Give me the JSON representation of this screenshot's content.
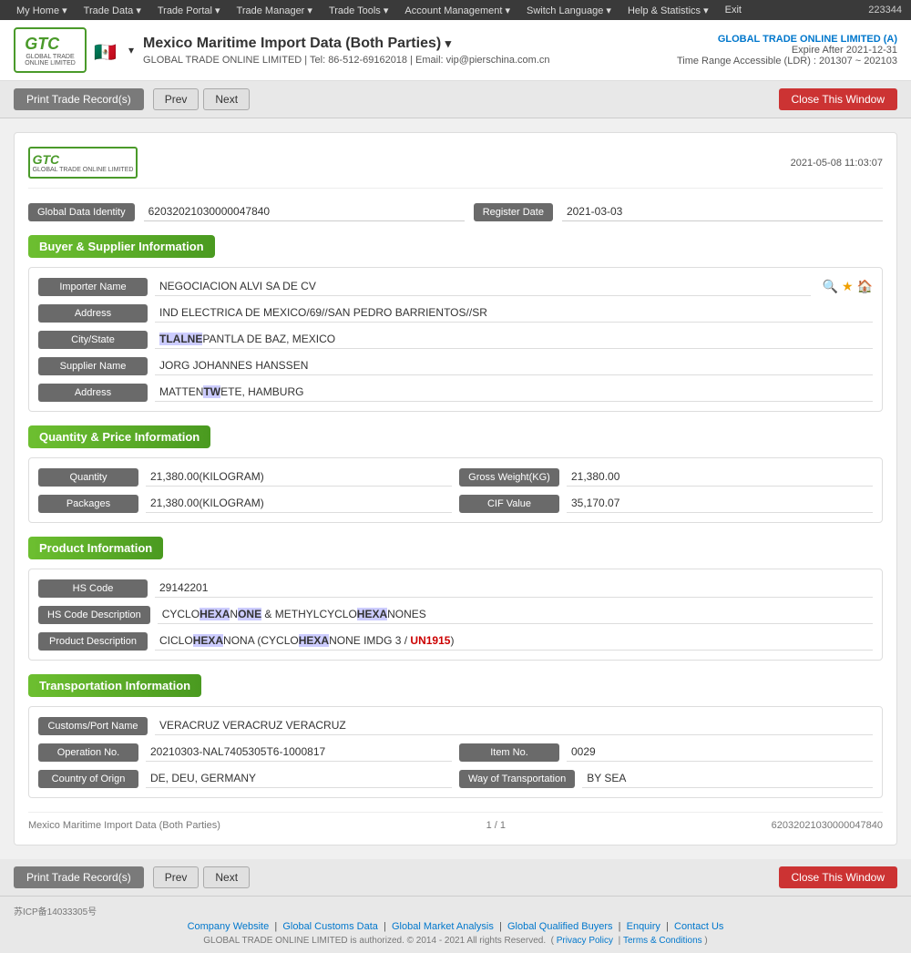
{
  "topnav": {
    "items": [
      "My Home",
      "Trade Data",
      "Trade Portal",
      "Trade Manager",
      "Trade Tools",
      "Account Management",
      "Switch Language",
      "Help & Statistics",
      "Exit"
    ],
    "account_id": "223344"
  },
  "header": {
    "logo_text": "GTC",
    "logo_sub": "GLOBAL TRADE ONLINE LIMITED",
    "flag_emoji": "🇲🇽",
    "title": "Mexico Maritime Import Data (Both Parties)",
    "contact": "GLOBAL TRADE ONLINE LIMITED | Tel: 86-512-69162018 | Email: vip@pierschina.com.cn",
    "account_name": "GLOBAL TRADE ONLINE LIMITED (A)",
    "expire": "Expire After 2021-12-31",
    "time_range": "Time Range Accessible (LDR) : 201307 ~ 202103"
  },
  "toolbar": {
    "print_label": "Print Trade Record(s)",
    "prev_label": "Prev",
    "next_label": "Next",
    "close_label": "Close This Window"
  },
  "record": {
    "datetime": "2021-05-08 11:03:07",
    "global_data_identity_label": "Global Data Identity",
    "global_data_identity_value": "62032021030000047840",
    "register_date_label": "Register Date",
    "register_date_value": "2021-03-03",
    "buyer_supplier_section": "Buyer & Supplier Information",
    "importer_name_label": "Importer Name",
    "importer_name_value": "NEGOCIACION ALVI SA DE CV",
    "address1_label": "Address",
    "address1_value": "IND ELECTRICA DE MEXICO/69//SAN PEDRO BARRIENTOS//SR",
    "city_state_label": "City/State",
    "city_state_value": "TLALNEPANTLA DE BAZ, MEXICO",
    "supplier_name_label": "Supplier Name",
    "supplier_name_value": "JORG JOHANNES HANSSEN",
    "address2_label": "Address",
    "address2_value": "MATTENTWETE, HAMBURG",
    "qty_price_section": "Quantity & Price Information",
    "quantity_label": "Quantity",
    "quantity_value": "21,380.00(KILOGRAM)",
    "gross_weight_label": "Gross Weight(KG)",
    "gross_weight_value": "21,380.00",
    "packages_label": "Packages",
    "packages_value": "21,380.00(KILOGRAM)",
    "cif_value_label": "CIF Value",
    "cif_value_value": "35,170.07",
    "product_section": "Product Information",
    "hs_code_label": "HS Code",
    "hs_code_value": "29142201",
    "hs_code_desc_label": "HS Code Description",
    "hs_code_desc_value": "CYCLOHEXANONE & METHYLCYCLOHEXANONES",
    "product_desc_label": "Product Description",
    "product_desc_value": "CICLOHEXANONA (CYCLOHEXANONE IMDG 3 / UN1915)",
    "transport_section": "Transportation Information",
    "customs_label": "Customs/Port Name",
    "customs_value": "VERACRUZ VERACRUZ VERACRUZ",
    "operation_label": "Operation No.",
    "operation_value": "20210303-NAL7405305T6-1000817",
    "item_no_label": "Item No.",
    "item_no_value": "0029",
    "country_label": "Country of Orign",
    "country_value": "DE, DEU, GERMANY",
    "way_transport_label": "Way of Transportation",
    "way_transport_value": "BY SEA",
    "footer_title": "Mexico Maritime Import Data (Both Parties)",
    "footer_page": "1 / 1",
    "footer_id": "62032021030000047840"
  },
  "page_footer": {
    "icp": "苏ICP备14033305号",
    "links": [
      "Company Website",
      "Global Customs Data",
      "Global Market Analysis",
      "Global Qualified Buyers",
      "Enquiry",
      "Contact Us"
    ],
    "separator": "|",
    "copy": "GLOBAL TRADE ONLINE LIMITED is authorized. © 2014 - 2021 All rights Reserved.",
    "privacy": "Privacy Policy",
    "terms": "Terms & Conditions"
  }
}
